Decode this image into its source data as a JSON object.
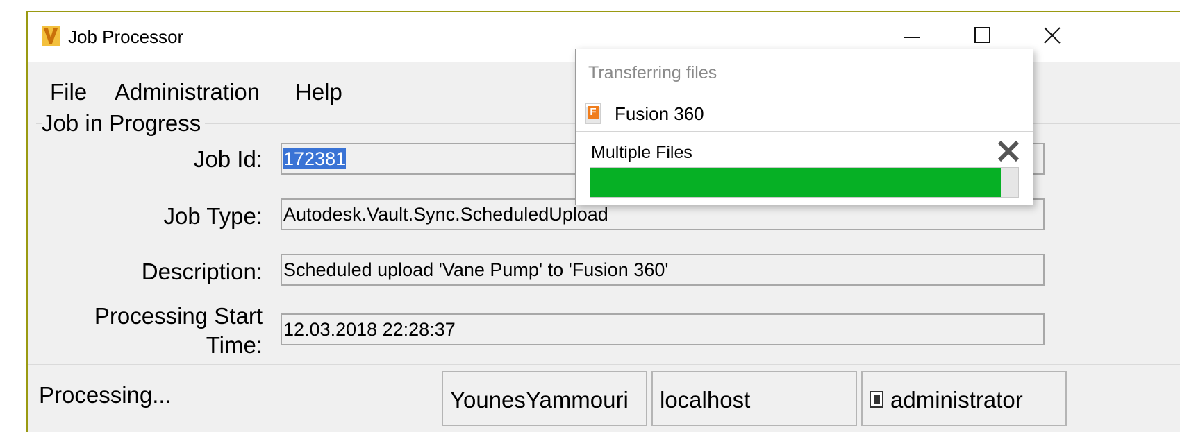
{
  "window": {
    "title": "Job Processor",
    "icon": "autodesk-vault-icon"
  },
  "menu": {
    "items": [
      "File",
      "Administration",
      "Help"
    ]
  },
  "job_group": {
    "label": "Job in Progress",
    "fields": [
      {
        "label": "Job Id:",
        "value": "172381"
      },
      {
        "label": "Job Type:",
        "value": "Autodesk.Vault.Sync.ScheduledUpload"
      },
      {
        "label": "Description:",
        "value": "Scheduled upload 'Vane Pump' to 'Fusion 360'"
      },
      {
        "label": "Processing Start",
        "label2": "Time:",
        "value": "12.03.2018 22:28:37"
      }
    ]
  },
  "status": {
    "text": "Processing...",
    "panels": [
      "YounesYammouri",
      "localhost",
      "administrator"
    ]
  },
  "popup": {
    "heading": "Transferring files",
    "app_name": "Fusion 360",
    "app_icon": "fusion-360-icon",
    "file_label": "Multiple Files",
    "progress": 0.96,
    "colors": {
      "progress_fill": "#06b025"
    }
  }
}
